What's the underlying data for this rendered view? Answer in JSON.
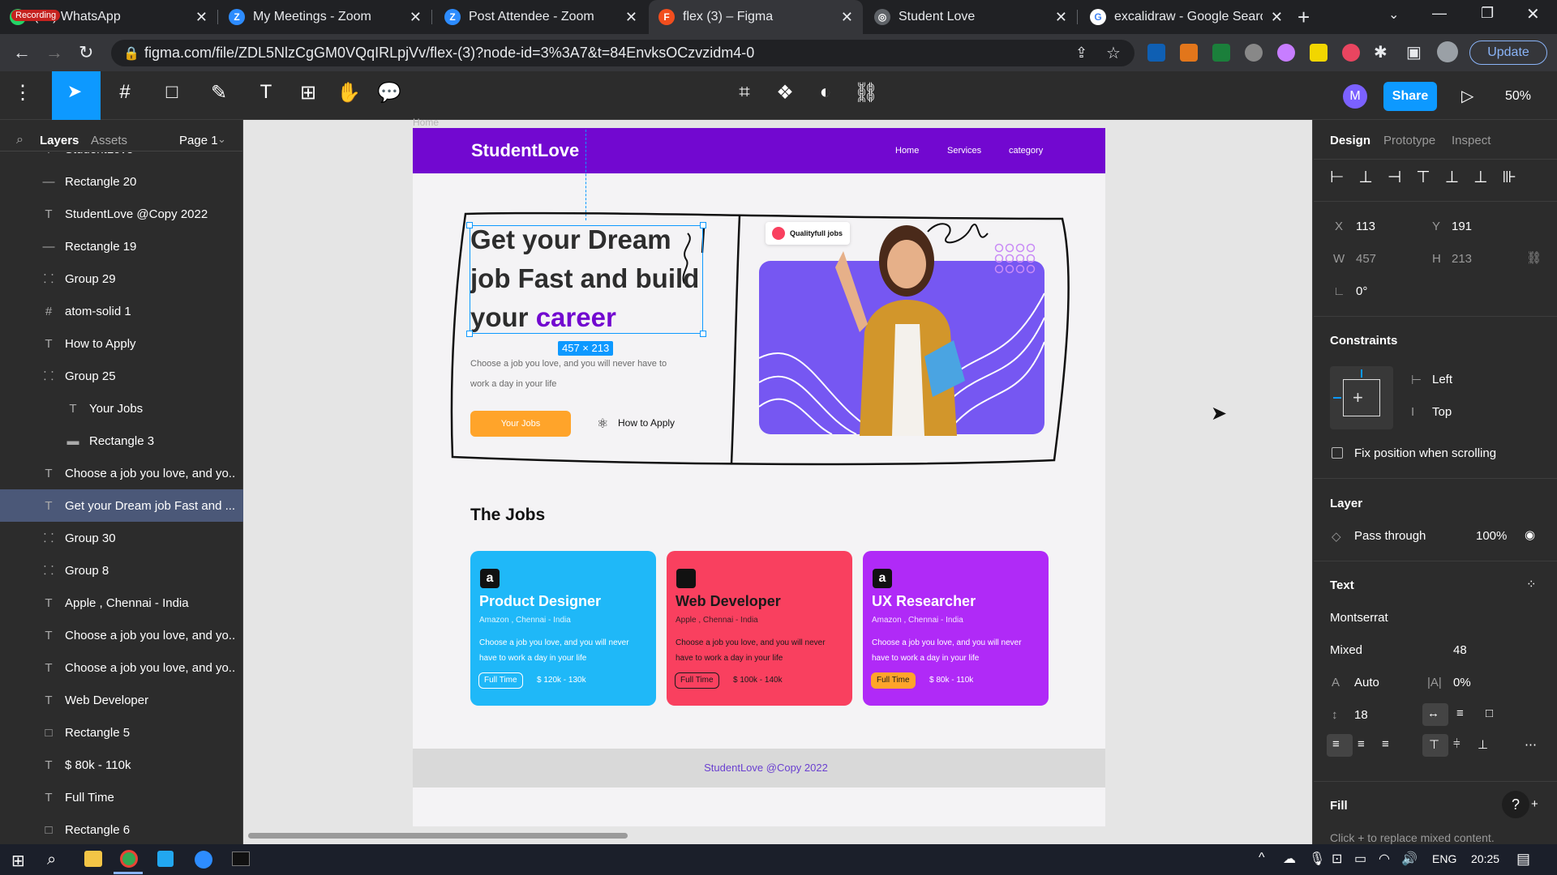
{
  "browser": {
    "tabs": [
      {
        "title": "(31) WhatsApp",
        "fav_color": "#25d366"
      },
      {
        "title": "My Meetings - Zoom",
        "fav_color": "#2d8cff"
      },
      {
        "title": "Post Attendee - Zoom",
        "fav_color": "#2d8cff"
      },
      {
        "title": "flex (3) – Figma",
        "fav_color": "#f24e1e"
      },
      {
        "title": "Student Love",
        "fav_color": "#9aa0a6"
      },
      {
        "title": "excalidraw - Google Search",
        "fav_color": "#ffffff"
      }
    ],
    "recording_label": "Recording",
    "url": "figma.com/file/ZDL5NlzCgGM0VQqIRLpjVv/flex-(3)?node-id=3%3A7&t=84EnvksOCzvzidm4-0",
    "update_label": "Update"
  },
  "figma": {
    "toolbar": {
      "share_label": "Share",
      "zoom": "50%",
      "avatar_initial": "M"
    },
    "left_tabs": {
      "layers": "Layers",
      "assets": "Assets",
      "page": "Page 1"
    },
    "layers": [
      {
        "icon": "T",
        "label": "StudentLove",
        "indent": 0
      },
      {
        "icon": "—",
        "label": "Rectangle 20",
        "indent": 0
      },
      {
        "icon": "T",
        "label": "StudentLove @Copy 2022",
        "indent": 0
      },
      {
        "icon": "—",
        "label": "Rectangle 19",
        "indent": 0
      },
      {
        "icon": "⸬",
        "label": "Group 29",
        "indent": 0
      },
      {
        "icon": "#",
        "label": "atom-solid 1",
        "indent": 0
      },
      {
        "icon": "T",
        "label": "How to Apply",
        "indent": 0
      },
      {
        "icon": "⸬",
        "label": "Group 25",
        "indent": 0
      },
      {
        "icon": "T",
        "label": "Your Jobs",
        "indent": 1
      },
      {
        "icon": "▬",
        "label": "Rectangle 3",
        "indent": 1
      },
      {
        "icon": "T",
        "label": "Choose a job you love, and yo...",
        "indent": 0
      },
      {
        "icon": "T",
        "label": "Get your Dream job Fast and ...",
        "indent": 0,
        "selected": true
      },
      {
        "icon": "⸬",
        "label": "Group 30",
        "indent": 0
      },
      {
        "icon": "⸬",
        "label": "Group 8",
        "indent": 0
      },
      {
        "icon": "T",
        "label": "Apple , Chennai - India",
        "indent": 0
      },
      {
        "icon": "T",
        "label": "Choose a job you love, and yo...",
        "indent": 0
      },
      {
        "icon": "T",
        "label": "Choose a job you love, and yo...",
        "indent": 0
      },
      {
        "icon": "T",
        "label": "Web Developer",
        "indent": 0
      },
      {
        "icon": "□",
        "label": "Rectangle 5",
        "indent": 0
      },
      {
        "icon": "T",
        "label": "$ 80k - 110k",
        "indent": 0
      },
      {
        "icon": "T",
        "label": "Full Time",
        "indent": 0
      },
      {
        "icon": "□",
        "label": "Rectangle 6",
        "indent": 0
      }
    ],
    "design": {
      "tabs": {
        "design": "Design",
        "prototype": "Prototype",
        "inspect": "Inspect"
      },
      "x": "113",
      "y": "191",
      "w": "457",
      "h": "213",
      "rotation": "0°",
      "constraints_title": "Constraints",
      "constraint_h": "Left",
      "constraint_v": "Top",
      "fix_position": "Fix position when scrolling",
      "layer_title": "Layer",
      "blend": "Pass through",
      "opacity": "100%",
      "text_title": "Text",
      "font": "Montserrat",
      "weight": "Mixed",
      "size": "48",
      "auto_label": "Auto",
      "letter_spacing": "0%",
      "line_height": "18",
      "fill_title": "Fill",
      "fill_note": "Click + to replace mixed content."
    },
    "selection_size": "457 × 213",
    "frame_label": "Home"
  },
  "site": {
    "brand": "StudentLove",
    "nav": [
      "Home",
      "Services",
      "category"
    ],
    "hero": {
      "line1": "Get your Dream",
      "line2": "job Fast and build",
      "line3_plain": "your ",
      "line3_accent": "career",
      "desc1": "Choose a job you love, and you will never have to",
      "desc2": "work a day in your life",
      "btn_primary": "Your Jobs",
      "btn_secondary": "How to Apply",
      "badge": "Qualityfull jobs"
    },
    "jobs_title": "The Jobs",
    "jobs": [
      {
        "logo": "a",
        "title": "Product Designer",
        "company": "Amazon , Chennai - India",
        "desc1": "Choose a job you love, and you will never",
        "desc2": "have to work a day in your life",
        "type": "Full Time",
        "salary": "$ 120k - 130k",
        "color": "#1fb8f8"
      },
      {
        "logo": "",
        "title": "Web Developer",
        "company": "Apple , Chennai - India",
        "desc1": "Choose a job you love, and you will never",
        "desc2": "have to work a day in your life",
        "type": "Full Time",
        "salary": "$ 100k - 140k",
        "color": "#f9405f"
      },
      {
        "logo": "a",
        "title": "UX Researcher",
        "company": "Amazon , Chennai - India",
        "desc1": "Choose a job you love, and you will never",
        "desc2": "have to work a day in your life",
        "type": "Full Time",
        "salary": "$ 80k - 110k",
        "color": "#b02af7"
      }
    ],
    "footer": "StudentLove @Copy 2022"
  },
  "taskbar": {
    "lang": "ENG",
    "time": "20:25"
  }
}
